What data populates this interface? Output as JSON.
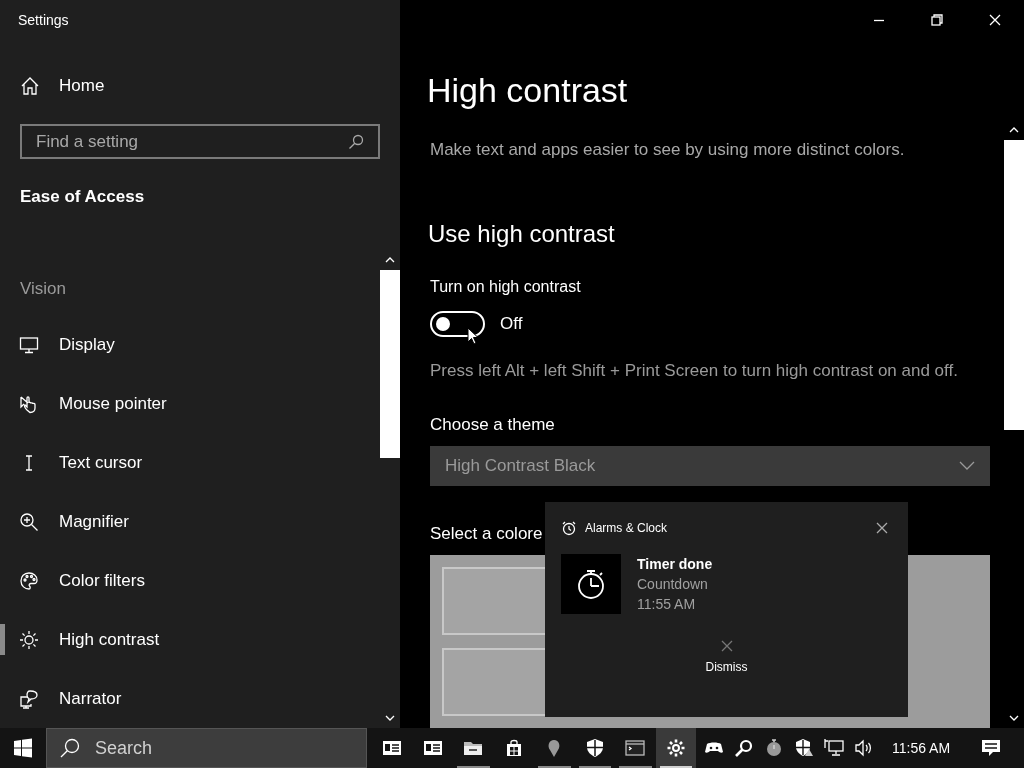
{
  "window": {
    "title": "Settings"
  },
  "sidebar": {
    "home": "Home",
    "search": {
      "placeholder": "Find a setting"
    },
    "category": "Ease of Access",
    "section": "Vision",
    "items": [
      {
        "label": "Display",
        "selected": false
      },
      {
        "label": "Mouse pointer",
        "selected": false
      },
      {
        "label": "Text cursor",
        "selected": false
      },
      {
        "label": "Magnifier",
        "selected": false
      },
      {
        "label": "Color filters",
        "selected": false
      },
      {
        "label": "High contrast",
        "selected": true
      },
      {
        "label": "Narrator",
        "selected": false
      }
    ]
  },
  "page": {
    "title": "High contrast",
    "description": "Make text and apps easier to see by using more distinct colors.",
    "section_title": "Use high contrast",
    "toggle": {
      "label": "Turn on high contrast",
      "on": false,
      "state_text": "Off"
    },
    "hint": "Press left Alt + left Shift + Print Screen to turn high contrast on and off.",
    "theme": {
      "label": "Choose a theme",
      "value": "High Contrast Black",
      "disabled": true
    },
    "preview": {
      "label": "Select a colore"
    }
  },
  "notification": {
    "app": "Alarms & Clock",
    "title": "Timer done",
    "lines": [
      "Countdown",
      "11:55 AM"
    ],
    "action": "Dismiss"
  },
  "taskbar": {
    "search_placeholder": "Search",
    "apps": [
      {
        "running": false,
        "active": false
      },
      {
        "running": false,
        "active": false
      },
      {
        "running": true,
        "active": false
      },
      {
        "running": false,
        "active": false
      },
      {
        "running": true,
        "active": false
      },
      {
        "running": true,
        "active": false
      },
      {
        "running": true,
        "active": false
      },
      {
        "running": true,
        "active": true
      }
    ],
    "clock": "11:56 AM"
  }
}
